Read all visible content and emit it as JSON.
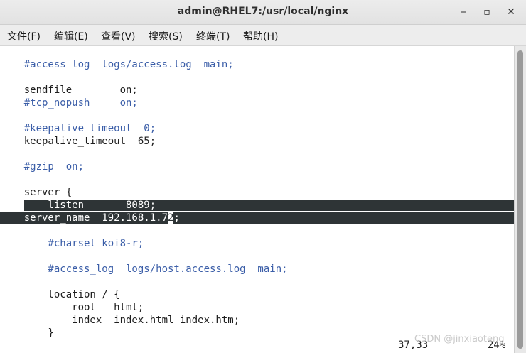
{
  "window": {
    "title": "admin@RHEL7:/usr/local/nginx",
    "minimize_glyph": "‒",
    "maximize_glyph": "▫",
    "close_glyph": "✕"
  },
  "menu": [
    "文件(F)",
    "编辑(E)",
    "查看(V)",
    "搜索(S)",
    "终端(T)",
    "帮助(H)"
  ],
  "lines": [
    "    #access_log  logs/access.log  main;",
    "",
    "    sendfile        on;",
    "    #tcp_nopush     on;",
    "",
    "    #keepalive_timeout  0;",
    "    keepalive_timeout  65;",
    "",
    "    #gzip  on;",
    "",
    "    server {",
    "        listen       8089;",
    "        server_name  192.168.1.72;",
    "",
    "        #charset koi8-r;",
    "",
    "        #access_log  logs/host.access.log  main;",
    "",
    "        location / {",
    "            root   html;",
    "            index  index.html index.htm;",
    "        }"
  ],
  "selection": {
    "line1_pre": "    ",
    "line1_sel": "    listen       8089;",
    "line2_a": "    server_name  192.168.1.7",
    "line2_cursor": "2",
    "line2_b": ";"
  },
  "status": {
    "position": "37,33",
    "percent": "24%"
  },
  "watermark": "CSDN @jinxiaoteng"
}
